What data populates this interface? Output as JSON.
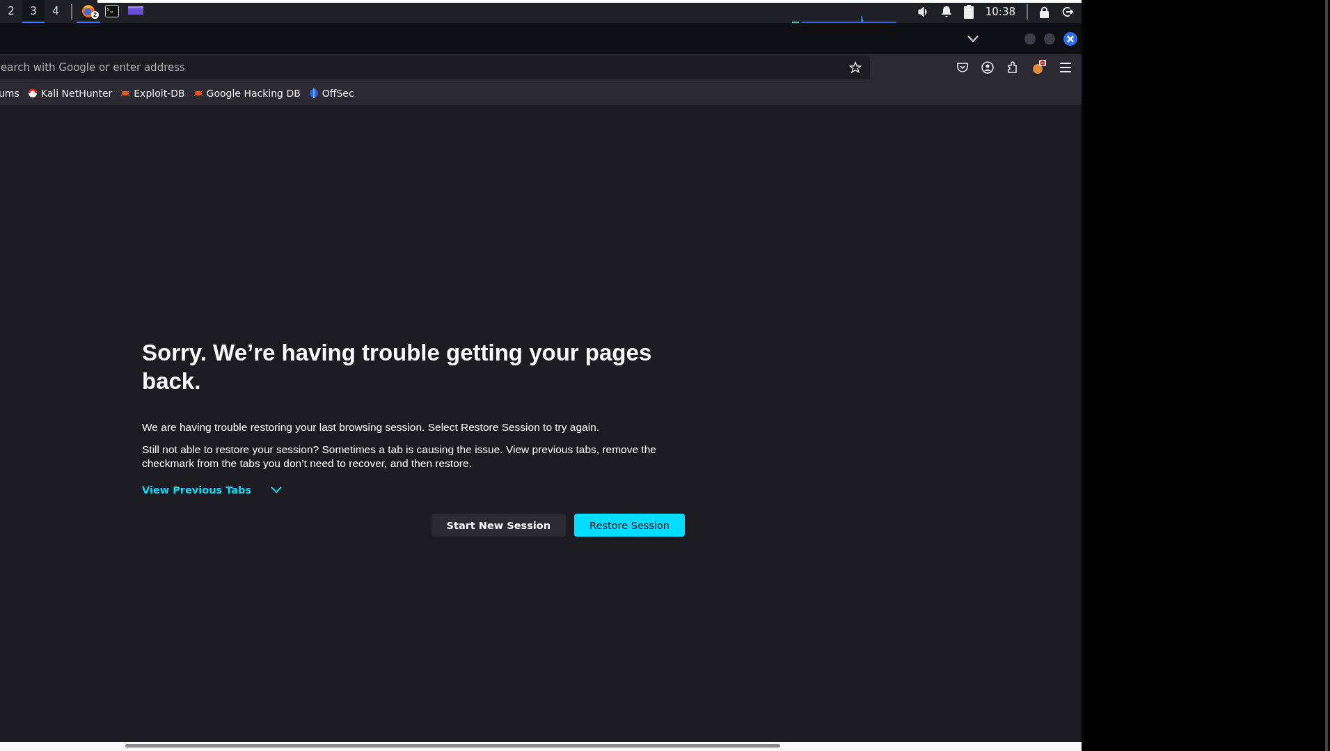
{
  "taskbar": {
    "workspaces": [
      {
        "label": "2",
        "selected": false
      },
      {
        "label": "3",
        "selected": true
      },
      {
        "label": "4",
        "selected": false
      }
    ],
    "apps": [
      {
        "kind": "browser",
        "selected": true,
        "badge": "2"
      },
      {
        "kind": "terminal",
        "selected": false
      },
      {
        "kind": "window",
        "selected": false
      }
    ],
    "clock": "10:38"
  },
  "address_bar": {
    "placeholder": "earch with Google or enter address"
  },
  "bookmarks": [
    {
      "label": "ums",
      "kind": "none"
    },
    {
      "label": "Kali NetHunter",
      "kind": "nethunter"
    },
    {
      "label": "Exploit-DB",
      "kind": "bug"
    },
    {
      "label": "Google Hacking DB",
      "kind": "bug"
    },
    {
      "label": "OffSec",
      "kind": "offsec"
    }
  ],
  "page": {
    "title": "Sorry. We’re having trouble getting your pages back.",
    "paragraphs": [
      "We are having trouble restoring your last browsing session. Select Restore Session to try again.",
      "Still not able to restore your session? Sometimes a tab is causing the issue. View previous tabs, remove the checkmark from the tabs you don’t need to recover, and then restore."
    ],
    "toggle": {
      "label": "View Previous Tabs",
      "expanded": false
    },
    "buttons": [
      {
        "label": "Start New Session",
        "kind": "secondary"
      },
      {
        "label": "Restore Session",
        "kind": "primary"
      }
    ]
  }
}
